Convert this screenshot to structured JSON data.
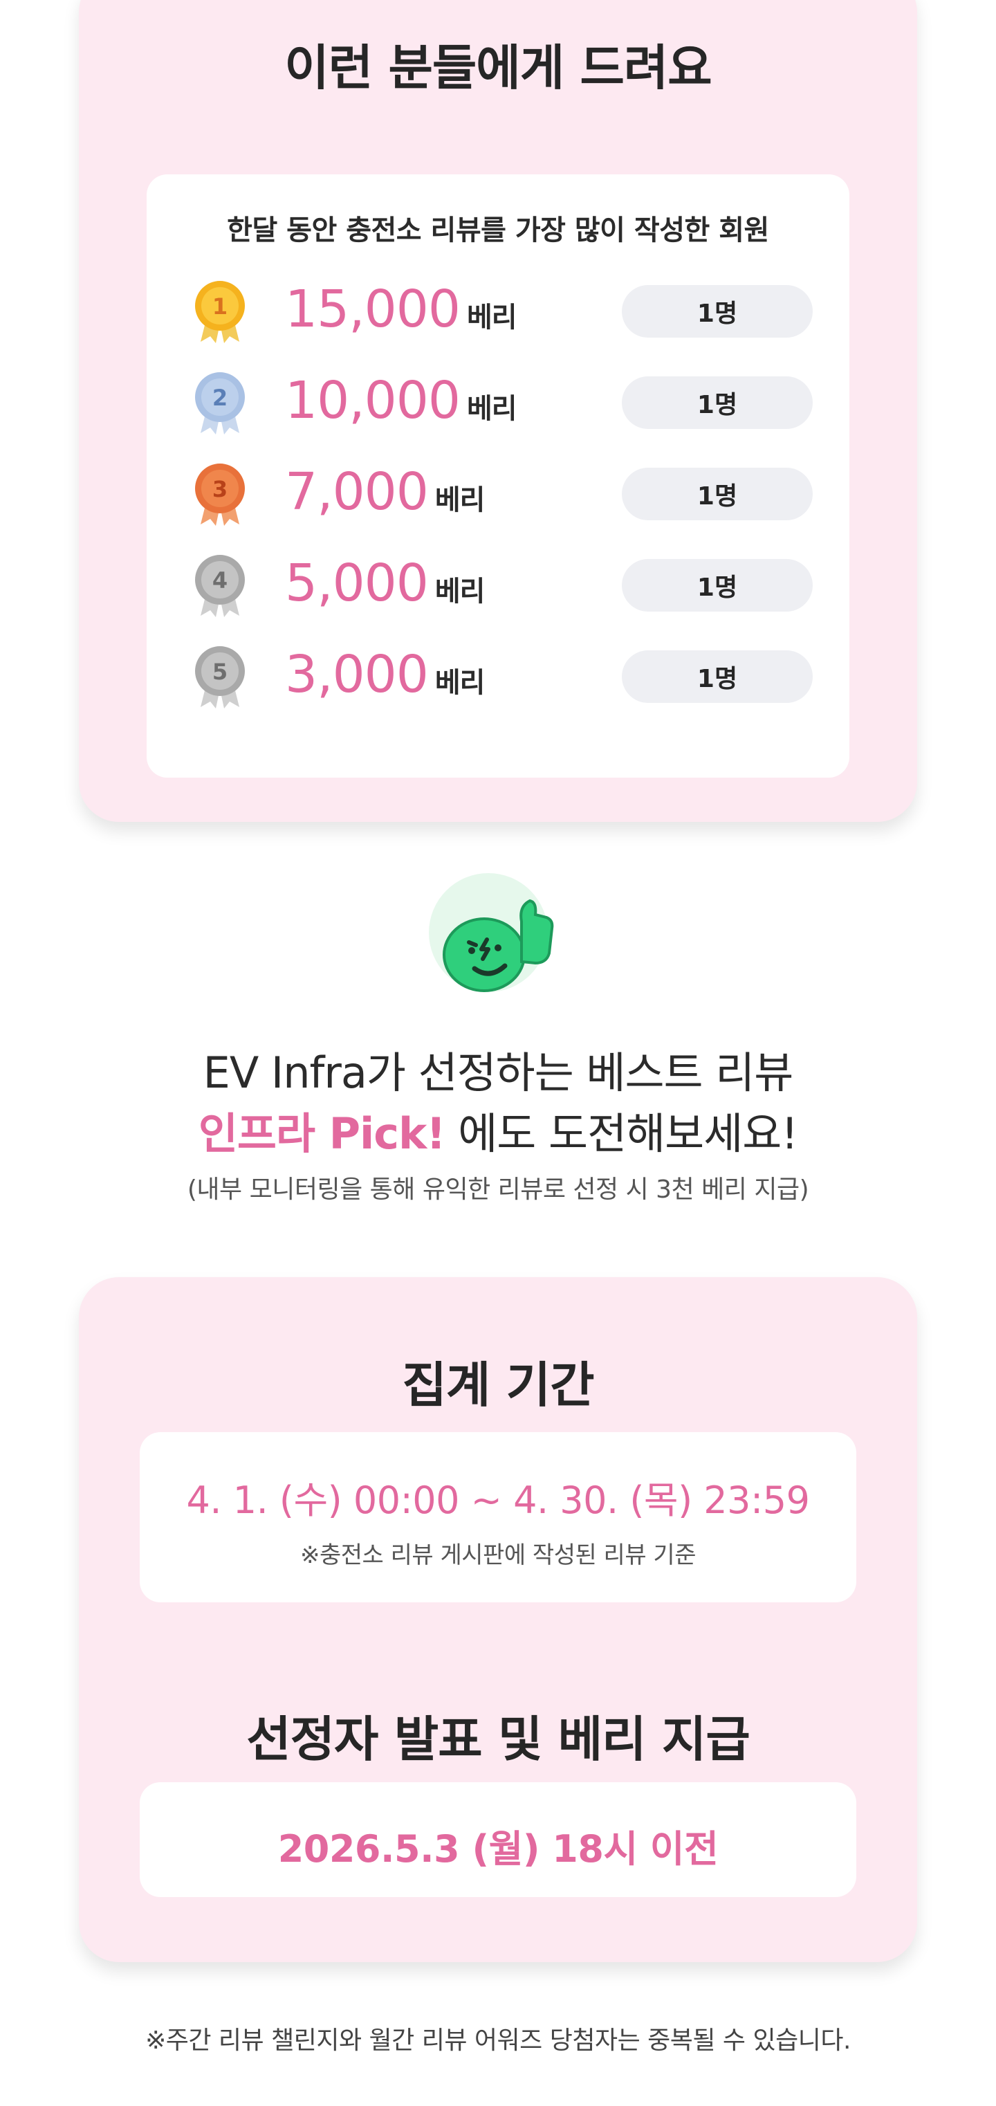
{
  "recipients": {
    "title": "이런 분들에게 드려요",
    "subtitle": "한달 동안 충전소 리뷰를 가장 많이 작성한 회원",
    "unit": "베리",
    "ranks": [
      {
        "rank": "1",
        "amount": "15,000",
        "count": "1명",
        "medal": "gold-medal-icon"
      },
      {
        "rank": "2",
        "amount": "10,000",
        "count": "1명",
        "medal": "silver-medal-icon"
      },
      {
        "rank": "3",
        "amount": "7,000",
        "count": "1명",
        "medal": "bronze-medal-icon"
      },
      {
        "rank": "4",
        "amount": "5,000",
        "count": "1명",
        "medal": "gray-medal-icon"
      },
      {
        "rank": "5",
        "amount": "3,000",
        "count": "1명",
        "medal": "gray-medal-icon"
      }
    ]
  },
  "pick": {
    "mascot_icon": "thumbs-up-mascot-icon",
    "line1": "EV Infra가 선정하는 베스트 리뷰",
    "line2_highlight": "인프라 Pick!",
    "line2_rest": " 에도 도전해보세요!",
    "note": "(내부 모니터링을 통해 유익한 리뷰로 선정 시 3천 베리 지급)"
  },
  "schedule": {
    "period_title": "집계 기간",
    "period_range": "4. 1. (수) 00:00 ~ 4. 30. (목) 23:59",
    "period_note": "※충전소 리뷰 게시판에 작성된 리뷰 기준",
    "announce_title": "선정자 발표 및 베리 지급",
    "announce_date": "2026.5.3 (월) 18시 이전"
  },
  "footer_note": "※주간 리뷰 챌린지와 월간 리뷰 어워즈 당첨자는 중복될 수 있습니다.",
  "colors": {
    "card_bg": "#fde9f1",
    "accent_pink": "#e2699e",
    "pill_bg": "#eeeff3",
    "mascot_green": "#2fcf7c",
    "gold": "#f5b21e",
    "silver": "#a9c1e4",
    "bronze": "#e8713a",
    "gray_medal": "#a9a9a9"
  }
}
